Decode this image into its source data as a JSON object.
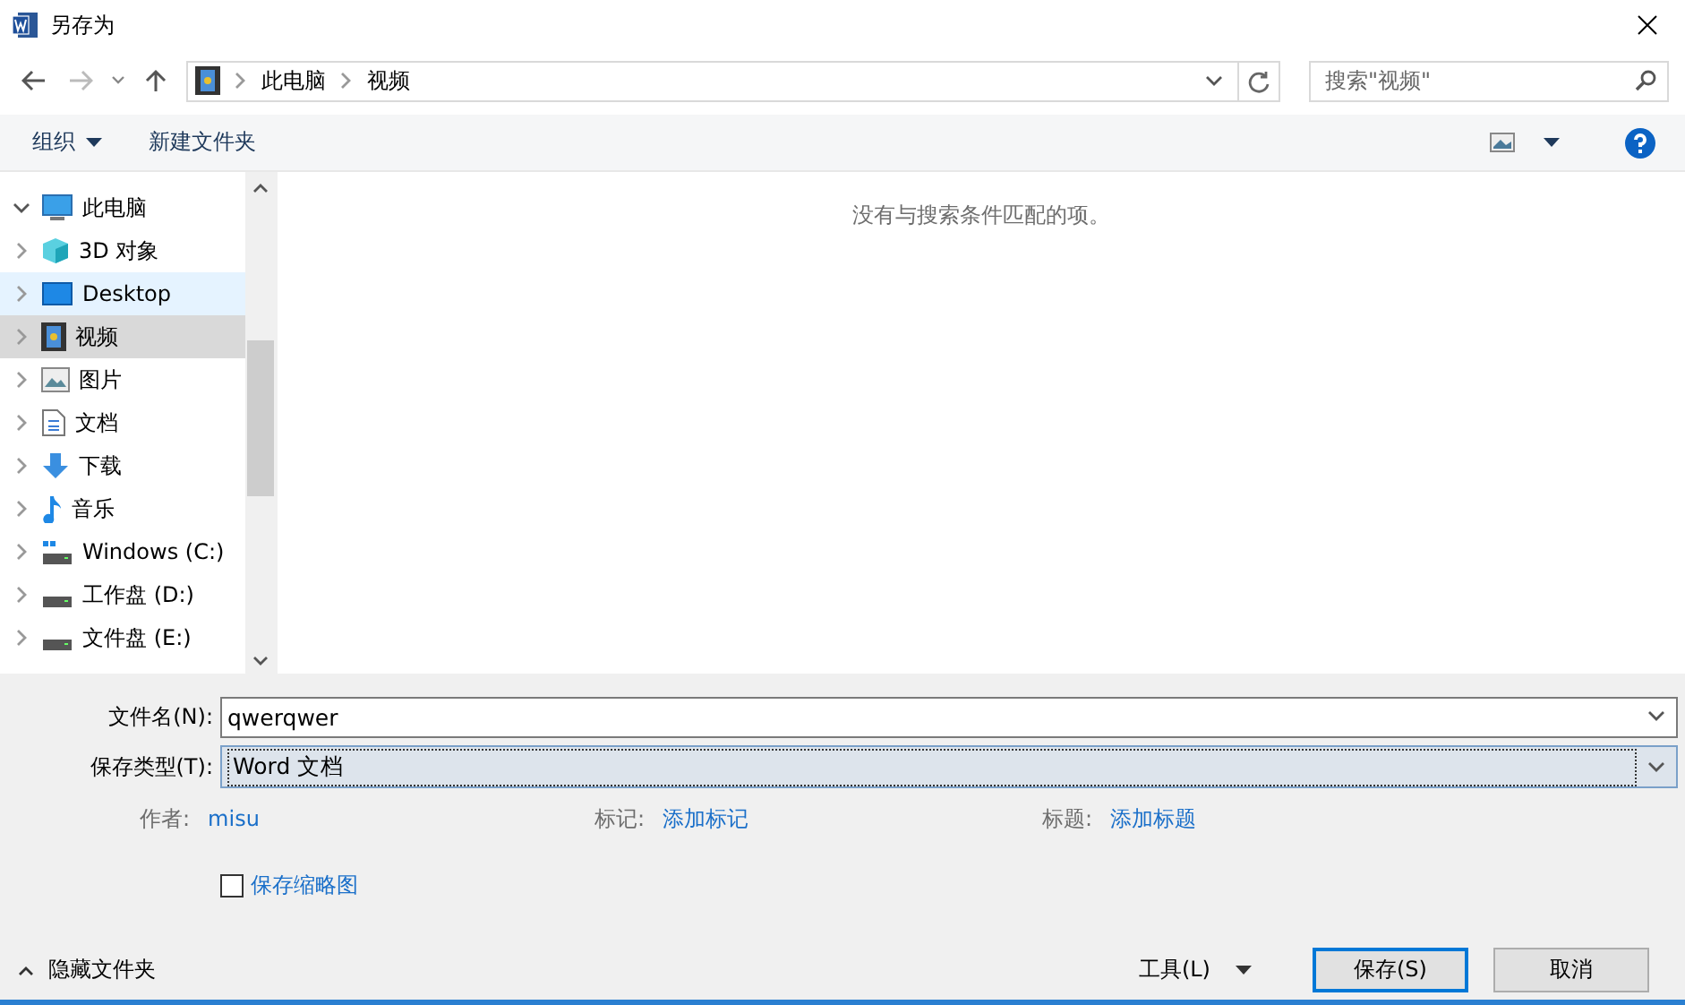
{
  "window": {
    "title": "另存为"
  },
  "address": {
    "path": [
      {
        "label": "此电脑"
      },
      {
        "label": "视频"
      }
    ]
  },
  "search": {
    "placeholder": "搜索\"视频\""
  },
  "toolbar": {
    "organize": "组织",
    "new_folder": "新建文件夹"
  },
  "sidebar": {
    "items": [
      {
        "label": "此电脑",
        "kind": "pc",
        "expanded": true,
        "selected": false,
        "hover": false,
        "children": [
          {
            "label": "3D 对象",
            "kind": "cube",
            "expanded": false,
            "selected": false,
            "hover": false
          },
          {
            "label": "Desktop",
            "kind": "desktop",
            "expanded": false,
            "selected": false,
            "hover": true
          },
          {
            "label": "视频",
            "kind": "film",
            "expanded": false,
            "selected": true,
            "hover": false
          },
          {
            "label": "图片",
            "kind": "image",
            "expanded": false,
            "selected": false,
            "hover": false
          },
          {
            "label": "文档",
            "kind": "doc",
            "expanded": false,
            "selected": false,
            "hover": false
          },
          {
            "label": "下载",
            "kind": "download",
            "expanded": false,
            "selected": false,
            "hover": false
          },
          {
            "label": "音乐",
            "kind": "music",
            "expanded": false,
            "selected": false,
            "hover": false
          },
          {
            "label": "Windows  (C:)",
            "kind": "windrive",
            "expanded": false,
            "selected": false,
            "hover": false
          },
          {
            "label": "工作盘 (D:)",
            "kind": "drive",
            "expanded": false,
            "selected": false,
            "hover": false
          },
          {
            "label": "文件盘 (E:)",
            "kind": "drive",
            "expanded": false,
            "selected": false,
            "hover": false
          }
        ]
      }
    ]
  },
  "content": {
    "empty_message": "没有与搜索条件匹配的项。"
  },
  "form": {
    "filename_label": "文件名(N):",
    "filename": "qwerqwer",
    "type_label": "保存类型(T):",
    "type": "Word 文档",
    "meta": [
      {
        "label": "作者:",
        "value": "misu"
      },
      {
        "label": "标记:",
        "value": "添加标记"
      },
      {
        "label": "标题:",
        "value": "添加标题"
      }
    ],
    "thumbnail": {
      "label": "保存缩略图",
      "checked": false
    }
  },
  "footer": {
    "hide_folders": "隐藏文件夹",
    "tools": "工具(L)",
    "save": "保存(S)",
    "cancel": "取消"
  }
}
